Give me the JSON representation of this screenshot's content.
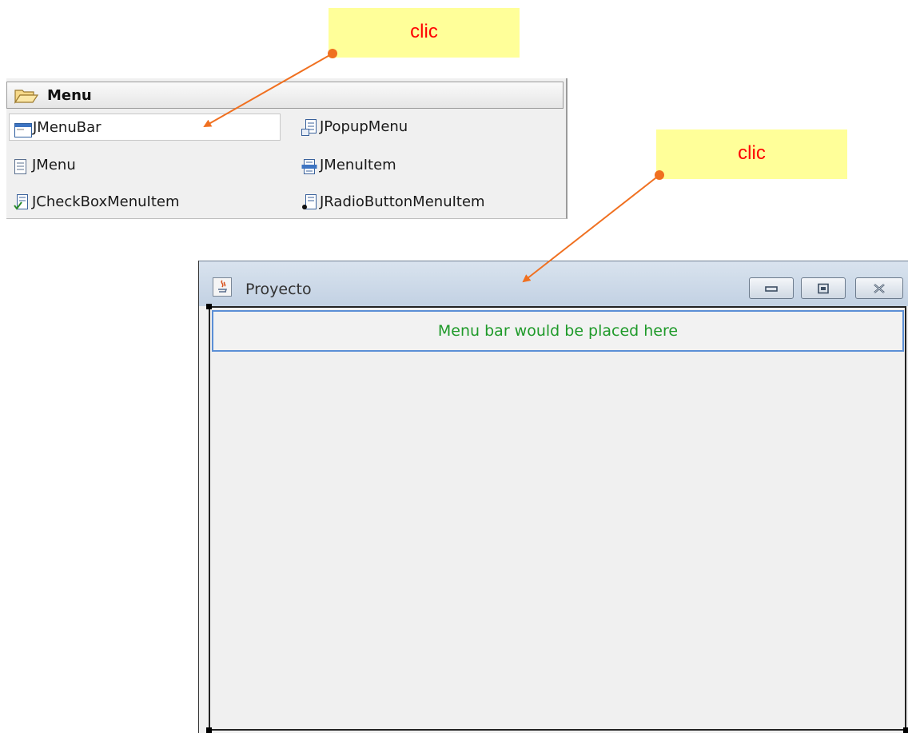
{
  "annotations": {
    "callout_1": "clic",
    "callout_2": "clic",
    "colors": {
      "callout_bg": "#ffff99",
      "callout_text": "#ff0000",
      "arrow": "#f07020"
    }
  },
  "palette": {
    "header": {
      "label": "Menu",
      "icon": "folder-open-icon"
    },
    "items": [
      {
        "label": "JMenuBar",
        "icon": "menubar-icon"
      },
      {
        "label": "JPopupMenu",
        "icon": "popup-menu-icon"
      },
      {
        "label": "JMenu",
        "icon": "menu-icon"
      },
      {
        "label": "JMenuItem",
        "icon": "menu-item-icon"
      },
      {
        "label": "JCheckBoxMenuItem",
        "icon": "checkbox-menu-item-icon"
      },
      {
        "label": "JRadioButtonMenuItem",
        "icon": "radio-menu-item-icon"
      }
    ]
  },
  "window": {
    "title": "Proyecto",
    "app_icon": "java-icon",
    "placeholder_text": "Menu bar would be placed here",
    "controls": [
      "minimize-icon",
      "maximize-icon",
      "close-icon"
    ]
  }
}
